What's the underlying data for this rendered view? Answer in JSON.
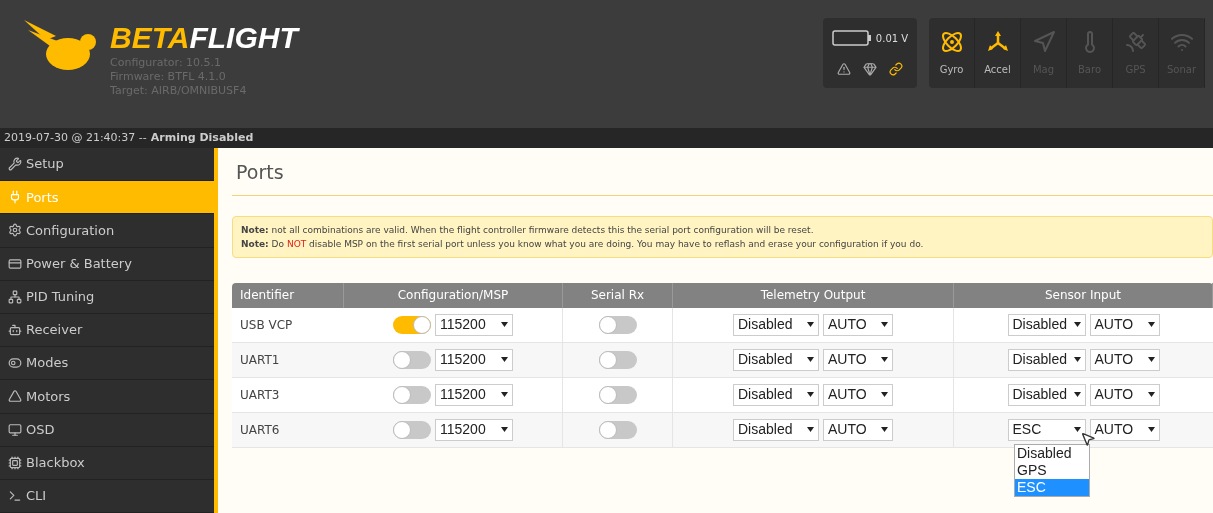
{
  "header": {
    "logo_left": "BETA",
    "logo_right": "FLIGHT",
    "info": [
      "Configurator: 10.5.1",
      "Firmware: BTFL 4.1.0",
      "Target: AIRB/OMNIBUSF4"
    ],
    "battery": {
      "reading": "0.01 V"
    },
    "status_icons": [
      {
        "kind": "warning",
        "active": false
      },
      {
        "kind": "parachute",
        "active": false
      },
      {
        "kind": "link",
        "active": true
      }
    ],
    "sensors": [
      {
        "kind": "gyro",
        "label": "Gyro",
        "active": true
      },
      {
        "kind": "accel",
        "label": "Accel",
        "active": true
      },
      {
        "kind": "mag",
        "label": "Mag",
        "active": false
      },
      {
        "kind": "baro",
        "label": "Baro",
        "active": false
      },
      {
        "kind": "gps",
        "label": "GPS",
        "active": false
      },
      {
        "kind": "sonar",
        "label": "Sonar",
        "active": false
      }
    ]
  },
  "status_bar": {
    "time": "2019-07-30 @ 21:40:37 --",
    "state": "Arming Disabled"
  },
  "sidebar": {
    "items": [
      {
        "kind": "setup",
        "label": "Setup",
        "selected": false
      },
      {
        "kind": "ports",
        "label": "Ports",
        "selected": true
      },
      {
        "kind": "configuration",
        "label": "Configuration",
        "selected": false
      },
      {
        "kind": "power",
        "label": "Power & Battery",
        "selected": false
      },
      {
        "kind": "pid",
        "label": "PID Tuning",
        "selected": false
      },
      {
        "kind": "receiver",
        "label": "Receiver",
        "selected": false
      },
      {
        "kind": "modes",
        "label": "Modes",
        "selected": false
      },
      {
        "kind": "motors",
        "label": "Motors",
        "selected": false
      },
      {
        "kind": "osd",
        "label": "OSD",
        "selected": false
      },
      {
        "kind": "blackbox",
        "label": "Blackbox",
        "selected": false
      },
      {
        "kind": "cli",
        "label": "CLI",
        "selected": false
      }
    ]
  },
  "page": {
    "title": "Ports",
    "notes": [
      {
        "label": "Note:",
        "before": "not all combinations are valid. When the flight controller firmware detects this the serial port configuration will be reset."
      },
      {
        "label": "Note:",
        "before": "Do ",
        "emphasis": "NOT",
        "after": " disable MSP on the first serial port unless you know what you are doing. You may have to reflash and erase your configuration if you do."
      }
    ],
    "table": {
      "columns": [
        "Identifier",
        "Configuration/MSP",
        "Serial Rx",
        "Telemetry Output",
        "Sensor Input"
      ],
      "rows": [
        {
          "identifier": "USB VCP",
          "msp": true,
          "msp_baud": "115200",
          "serial_rx": false,
          "telemetry": "Disabled",
          "telemetry_baud": "AUTO",
          "sensor": "Disabled",
          "sensor_baud": "AUTO"
        },
        {
          "identifier": "UART1",
          "msp": false,
          "msp_baud": "115200",
          "serial_rx": false,
          "telemetry": "Disabled",
          "telemetry_baud": "AUTO",
          "sensor": "Disabled",
          "sensor_baud": "AUTO"
        },
        {
          "identifier": "UART3",
          "msp": false,
          "msp_baud": "115200",
          "serial_rx": false,
          "telemetry": "Disabled",
          "telemetry_baud": "AUTO",
          "sensor": "Disabled",
          "sensor_baud": "AUTO"
        },
        {
          "identifier": "UART6",
          "msp": false,
          "msp_baud": "115200",
          "serial_rx": false,
          "telemetry": "Disabled",
          "telemetry_baud": "AUTO",
          "sensor": "ESC",
          "sensor_baud": "AUTO",
          "sensor_options": [
            {
              "label": "Disabled",
              "selected": false
            },
            {
              "label": "GPS",
              "selected": false
            },
            {
              "label": "ESC",
              "selected": true
            }
          ]
        }
      ]
    }
  }
}
